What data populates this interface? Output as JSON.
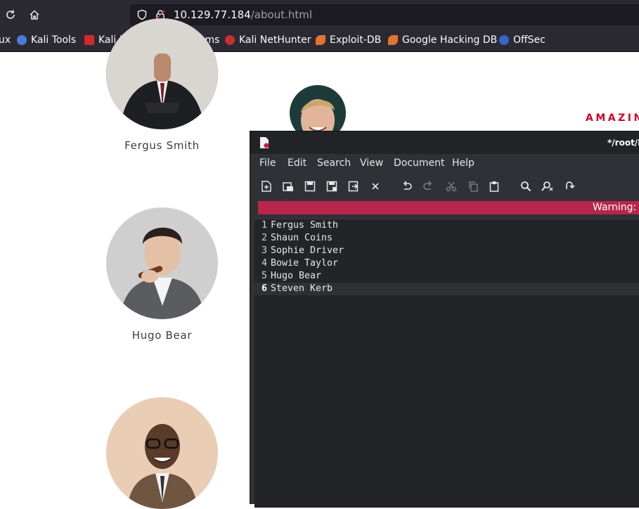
{
  "browser": {
    "url_host": "10.129.77.184",
    "url_path": "/about.html",
    "bookmarks": [
      {
        "label": "ux",
        "color": "#3d6fe0"
      },
      {
        "label": "Kali Tools",
        "color": "#4a7bd8"
      },
      {
        "label": "Kali Docs",
        "color": "#d12b2b"
      },
      {
        "label": "Kali Forums",
        "color": "#3f7ad9"
      },
      {
        "label": "Kali NetHunter",
        "color": "#c72f2f"
      },
      {
        "label": "Exploit-DB",
        "color": "#e0752d"
      },
      {
        "label": "Google Hacking DB",
        "color": "#e0752d"
      },
      {
        "label": "OffSec",
        "color": "#3b63c9"
      }
    ]
  },
  "page": {
    "people": [
      {
        "name": "Fergus Smith"
      },
      {
        "name": "Hugo Bear"
      },
      {
        "name": ""
      }
    ],
    "banner_partial": "AMAZIN"
  },
  "editor": {
    "title": "*/root/D",
    "menu": [
      "File",
      "Edit",
      "Search",
      "View",
      "Document",
      "Help"
    ],
    "tools": [
      "new-document",
      "new-window",
      "save",
      "save-as",
      "reload",
      "close",
      "undo",
      "redo",
      "cut",
      "copy",
      "paste",
      "find",
      "find-replace",
      "goto"
    ],
    "warning": "Warning: y",
    "lines": [
      {
        "num": "1",
        "text": "Fergus Smith"
      },
      {
        "num": "2",
        "text": "Shaun Coins"
      },
      {
        "num": "3",
        "text": "Sophie Driver"
      },
      {
        "num": "4",
        "text": "Bowie Taylor"
      },
      {
        "num": "5",
        "text": "Hugo Bear"
      },
      {
        "num": "6",
        "text": "Steven Kerb"
      }
    ],
    "current_line": 6
  }
}
